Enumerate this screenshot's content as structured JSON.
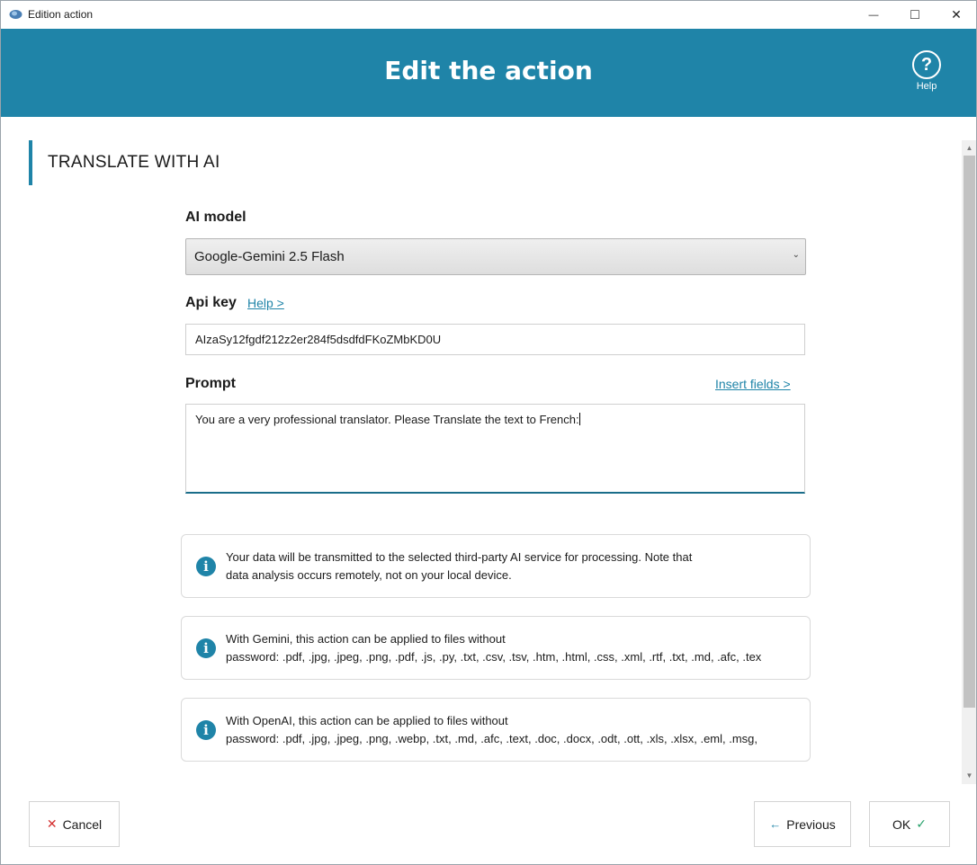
{
  "window": {
    "title": "Edition action",
    "minimize_glyph": "—",
    "maximize_glyph": "□",
    "close_glyph": "✕"
  },
  "header": {
    "title": "Edit the action",
    "help_label": "Help",
    "help_glyph": "?"
  },
  "section": {
    "title": "TRANSLATE WITH AI"
  },
  "form": {
    "ai_model_label": "AI model",
    "ai_model_value": "Google-Gemini 2.5 Flash",
    "api_key_label": "Api key",
    "api_key_help_link": "Help >",
    "api_key_value": "AIzaSy12fgdf212z2er284f5dsdfdFKoZMbKD0U",
    "prompt_label": "Prompt",
    "insert_fields_link": "Insert fields >",
    "prompt_value": "You are a very professional translator. Please Translate the text to French:"
  },
  "info_boxes": [
    {
      "line1": "Your data will be transmitted to the selected third-party AI service for processing. Note that",
      "line2": "data analysis occurs remotely, not on your local device."
    },
    {
      "line1": "With Gemini, this action can be applied to files without",
      "line2": "password: .pdf, .jpg, .jpeg, .png, .pdf, .js, .py, .txt, .csv, .tsv, .htm, .html, .css, .xml, .rtf, .txt, .md, .afc, .tex"
    },
    {
      "line1": "With OpenAI, this action can be applied to files without",
      "line2": "password: .pdf, .jpg, .jpeg, .png, .webp, .txt, .md, .afc, .text, .doc, .docx, .odt, .ott, .xls, .xlsx, .eml, .msg,"
    }
  ],
  "buttons": {
    "cancel": "Cancel",
    "previous": "Previous",
    "ok": "OK"
  },
  "colors": {
    "accent": "#1f84a8",
    "cancel_icon": "#d43030",
    "ok_icon": "#26a06a"
  }
}
